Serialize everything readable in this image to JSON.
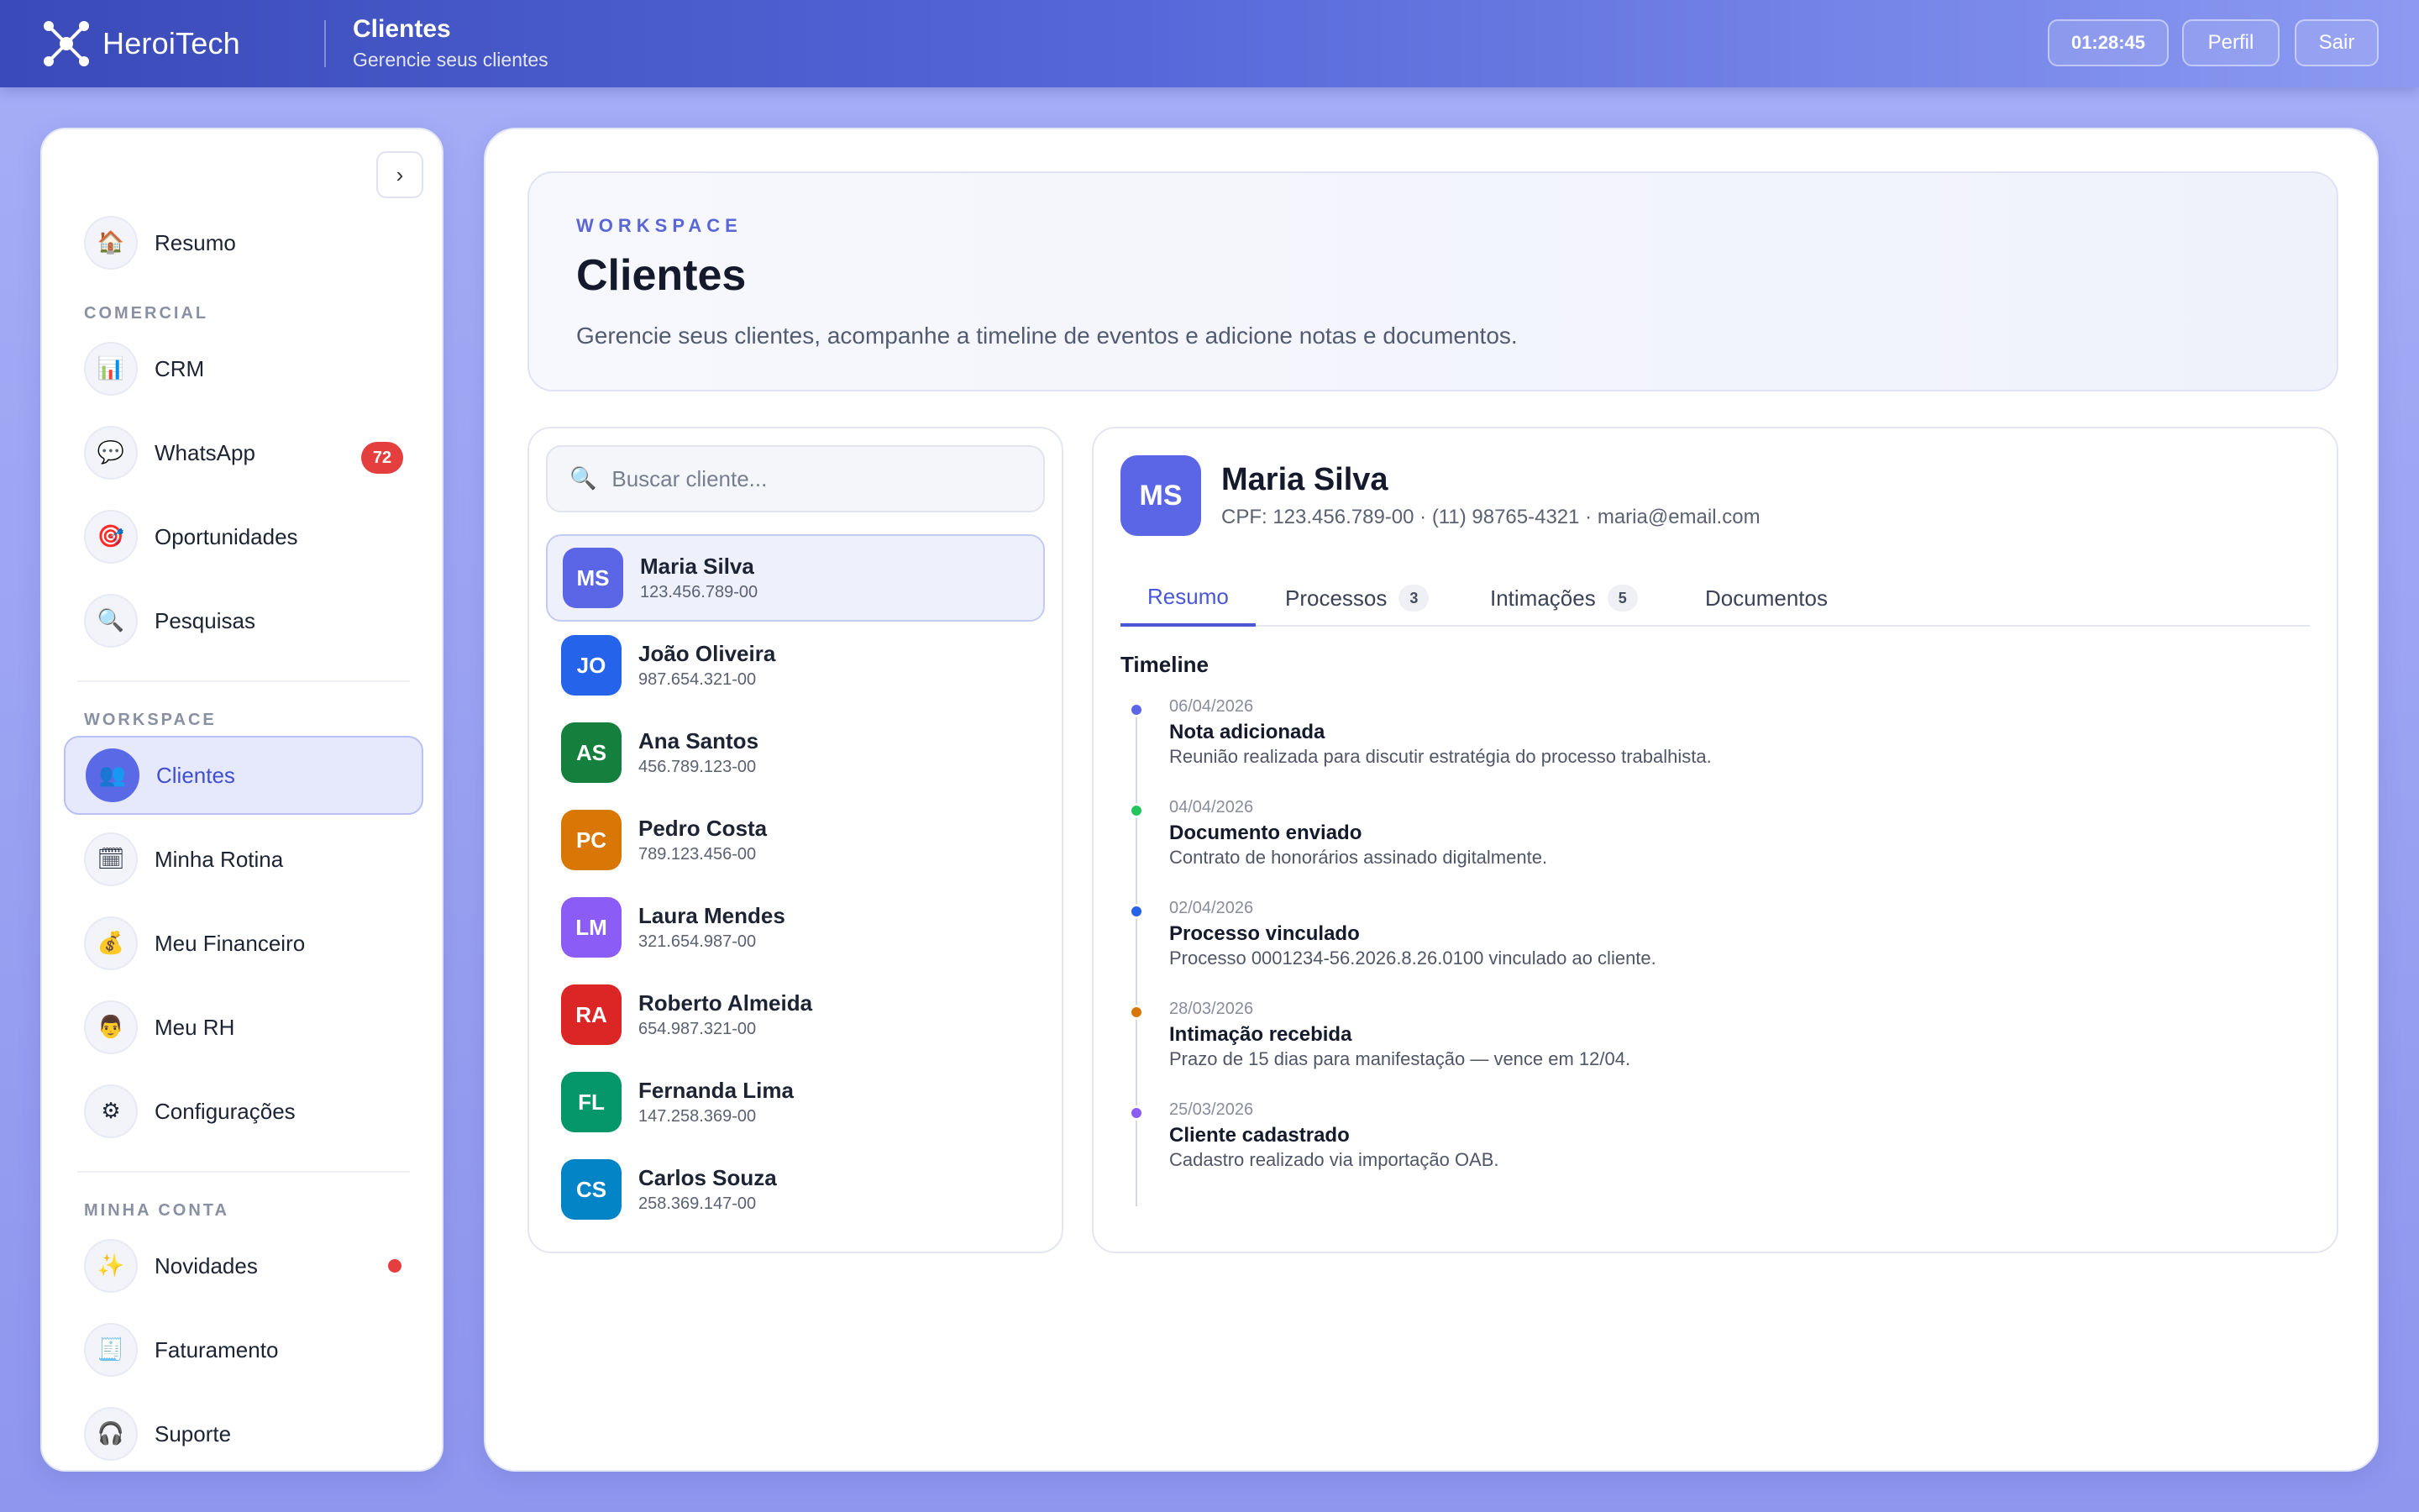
{
  "topbar": {
    "brand": "HeroiTech",
    "title": "Clientes",
    "subtitle": "Gerencie seus clientes",
    "clock": "01:28:45",
    "profile_label": "Perfil",
    "logout_label": "Sair"
  },
  "sidebar": {
    "collapse_label": "›",
    "summary": {
      "label": "Resumo",
      "icon": "🏠"
    },
    "sections": {
      "comercial": "COMERCIAL",
      "workspace": "WORKSPACE",
      "account": "MINHA CONTA"
    },
    "comercial_items": [
      {
        "label": "CRM",
        "icon": "📊"
      },
      {
        "label": "WhatsApp",
        "icon": "💬",
        "badge": "72"
      },
      {
        "label": "Oportunidades",
        "icon": "🎯"
      },
      {
        "label": "Pesquisas",
        "icon": "🔍"
      }
    ],
    "workspace_items": [
      {
        "label": "Clientes",
        "icon": "👥",
        "active": true
      },
      {
        "label": "Minha Rotina",
        "icon": "🗓"
      },
      {
        "label": "Meu Financeiro",
        "icon": "💰"
      },
      {
        "label": "Meu RH",
        "icon": "👨"
      },
      {
        "label": "Configurações",
        "icon": "⚙"
      }
    ],
    "account_items": [
      {
        "label": "Novidades",
        "icon": "✨"
      },
      {
        "label": "Faturamento",
        "icon": "🧾"
      },
      {
        "label": "Suporte",
        "icon": "🎧"
      }
    ]
  },
  "hero": {
    "eyebrow": "WORKSPACE",
    "title": "Clientes",
    "description": "Gerencie seus clientes, acompanhe a timeline de eventos e adicione notas e documentos."
  },
  "search": {
    "placeholder": "Buscar cliente...",
    "value": ""
  },
  "clients": [
    {
      "initials": "MS",
      "name": "Maria Silva",
      "cpf": "123.456.789-00",
      "color": "#5a66e6"
    },
    {
      "initials": "JO",
      "name": "João Oliveira",
      "cpf": "987.654.321-00",
      "color": "#2563eb"
    },
    {
      "initials": "AS",
      "name": "Ana Santos",
      "cpf": "456.789.123-00",
      "color": "#15803d"
    },
    {
      "initials": "PC",
      "name": "Pedro Costa",
      "cpf": "789.123.456-00",
      "color": "#d97706"
    },
    {
      "initials": "LM",
      "name": "Laura Mendes",
      "cpf": "321.654.987-00",
      "color": "#8b5cf6"
    },
    {
      "initials": "RA",
      "name": "Roberto Almeida",
      "cpf": "654.987.321-00",
      "color": "#dc2626"
    },
    {
      "initials": "FL",
      "name": "Fernanda Lima",
      "cpf": "147.258.369-00",
      "color": "#059669"
    },
    {
      "initials": "CS",
      "name": "Carlos Souza",
      "cpf": "258.369.147-00",
      "color": "#0284c7"
    }
  ],
  "detail": {
    "initials": "MS",
    "name": "Maria Silva",
    "meta": "CPF: 123.456.789-00 · (11) 98765-4321 · maria@email.com",
    "tabs": [
      {
        "label": "Resumo"
      },
      {
        "label": "Processos",
        "count": "3"
      },
      {
        "label": "Intimações",
        "count": "5"
      },
      {
        "label": "Documentos"
      }
    ],
    "timeline_title": "Timeline",
    "events": [
      {
        "date": "06/04/2026",
        "title": "Nota adicionada",
        "desc": "Reunião realizada para discutir estratégia do processo trabalhista.",
        "color": "#5a66e6"
      },
      {
        "date": "04/04/2026",
        "title": "Documento enviado",
        "desc": "Contrato de honorários assinado digitalmente.",
        "color": "#22c55e"
      },
      {
        "date": "02/04/2026",
        "title": "Processo vinculado",
        "desc": "Processo 0001234-56.2026.8.26.0100 vinculado ao cliente.",
        "color": "#2563eb"
      },
      {
        "date": "28/03/2026",
        "title": "Intimação recebida",
        "desc": "Prazo de 15 dias para manifestação — vence em 12/04.",
        "color": "#d97706"
      },
      {
        "date": "25/03/2026",
        "title": "Cliente cadastrado",
        "desc": "Cadastro realizado via importação OAB.",
        "color": "#8b5cf6"
      }
    ]
  }
}
